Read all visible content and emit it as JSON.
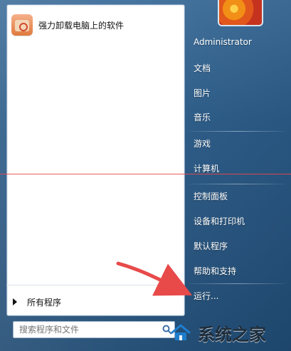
{
  "left_pane": {
    "pinned_program": {
      "label": "强力卸载电脑上的软件",
      "icon": "uninstaller-box-icon"
    },
    "all_programs": {
      "label": "所有程序",
      "icon": "triangle-right-icon"
    },
    "search": {
      "placeholder": "搜索程序和文件",
      "icon": "search-icon"
    }
  },
  "right_pane": {
    "user": {
      "label": "Administrator",
      "avatar_icon": "flower-avatar-icon"
    },
    "items": [
      {
        "label": "文档"
      },
      {
        "label": "图片"
      },
      {
        "label": "音乐"
      },
      {
        "label": "游戏"
      },
      {
        "label": "计算机"
      },
      {
        "label": "控制面板"
      },
      {
        "label": "设备和打印机"
      },
      {
        "label": "默认程序"
      },
      {
        "label": "帮助和支持"
      },
      {
        "label": "运行..."
      }
    ]
  },
  "watermark": {
    "text": "系统之家",
    "icon": "house-logo-icon"
  },
  "colors": {
    "annotation_red": "#e84a4a",
    "menu_blue": "#2a5a86"
  }
}
